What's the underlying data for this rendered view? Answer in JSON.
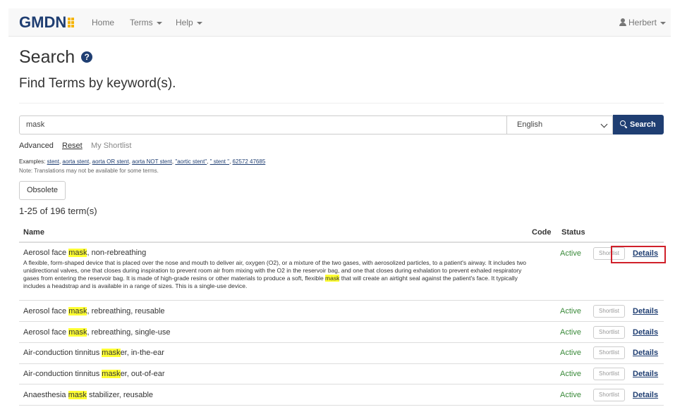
{
  "navbar": {
    "logo_text": "GMDN",
    "menu": [
      {
        "label": "Home",
        "has_caret": false
      },
      {
        "label": "Terms",
        "has_caret": true
      },
      {
        "label": "Help",
        "has_caret": true
      }
    ],
    "user": "Herbert"
  },
  "page": {
    "title": "Search",
    "subtitle": "Find Terms by keyword(s)."
  },
  "search": {
    "query": "mask",
    "language": "English",
    "button_label": "Search"
  },
  "links": {
    "advanced": "Advanced",
    "reset": "Reset",
    "shortlist": "My Shortlist"
  },
  "examples": {
    "prefix": "Examples:",
    "items": [
      "stent",
      "aorta stent",
      "aorta OR stent",
      "aorta NOT stent",
      "\"aortic stent\"",
      "\" stent \"",
      "62572 47685"
    ],
    "note": "Note: Translations may not be available for some terms."
  },
  "obsolete_button": "Obsolete",
  "result_count": "1-25 of 196 term(s)",
  "table": {
    "headers": {
      "name": "Name",
      "code": "Code",
      "status": "Status"
    },
    "shortlist_label": "Shortlist",
    "details_label": "Details",
    "rows": [
      {
        "name_pre": "Aerosol face ",
        "highlight": "mask",
        "name_post": ", non-rebreathing",
        "status": "Active",
        "desc_parts": [
          "A flexible, form-shaped device that is placed over the nose and mouth to deliver air, oxygen (O2), or a mixture of the two gases, with aerosolized particles, to a patient's airway. It includes two unidirectional valves, one that closes during inspiration to prevent room air from mixing with the O2 in the reservoir bag, and one that closes during exhalation to prevent exhaled respiratory gases from entering the reservoir bag. It is made of high-grade resins or other materials to produce a soft, flexible ",
          "mask",
          " that will create an airtight seal against the patient's face. It typically includes a headstrap and is available in a range of sizes. This is a single-use device."
        ]
      },
      {
        "name_pre": "Aerosol face ",
        "highlight": "mask",
        "name_post": ", rebreathing, reusable",
        "status": "Active"
      },
      {
        "name_pre": "Aerosol face ",
        "highlight": "mask",
        "name_post": ", rebreathing, single-use",
        "status": "Active"
      },
      {
        "name_pre": "Air-conduction tinnitus ",
        "highlight": "mask",
        "name_post": "er, in-the-ear",
        "status": "Active"
      },
      {
        "name_pre": "Air-conduction tinnitus ",
        "highlight": "mask",
        "name_post": "er, out-of-ear",
        "status": "Active"
      },
      {
        "name_pre": "Anaesthesia ",
        "highlight": "mask",
        "name_post": " stabilizer, reusable",
        "status": "Active"
      }
    ]
  },
  "colors": {
    "brand": "#1f3e72",
    "accent": "#f5b400",
    "highlight": "#ffff33",
    "active": "#3a8a3a",
    "annotation": "#d0202a"
  }
}
